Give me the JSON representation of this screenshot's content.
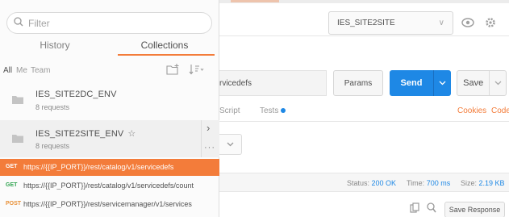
{
  "sidebar": {
    "search": {
      "placeholder": "Filter"
    },
    "tabs": [
      {
        "label": "History",
        "active": false
      },
      {
        "label": "Collections",
        "active": true
      }
    ],
    "filters": [
      {
        "label": "All",
        "active": true
      },
      {
        "label": "Me",
        "active": false
      },
      {
        "label": "Team",
        "active": false
      }
    ],
    "tools": {
      "new_collection_icon": "new-collection-icon",
      "sort_icon": "sort-icon"
    },
    "collections": [
      {
        "name": "IES_SITE2DC_ENV",
        "count": "8 requests"
      },
      {
        "name": "IES_SITE2SITE_ENV",
        "count": "8 requests",
        "star": "☆",
        "arrow": "›",
        "more": "···"
      }
    ],
    "requests": [
      {
        "method": "GET",
        "url": "https://{{IP_PORT}}/rest/catalog/v1/servicedefs",
        "active": true
      },
      {
        "method": "GET",
        "url": "https://{{IP_PORT}}/rest/catalog/v1/servicedefs/count",
        "active": false
      },
      {
        "method": "POST",
        "url": "https://{{IP_PORT}}/rest/servicemanager/v1/services",
        "active": false
      }
    ]
  },
  "main": {
    "environment": {
      "selected": "IES_SITE2SITE",
      "chevron": "∨"
    },
    "url_value": "rvicedefs",
    "params_label": "Params",
    "send_label": "Send",
    "save_label": "Save",
    "subtabs": {
      "script": "Script",
      "tests": "Tests",
      "cookies": "Cookies",
      "code": "Code"
    },
    "status": {
      "status_label": "Status:",
      "status_value": "200 OK",
      "time_label": "Time:",
      "time_value": "700 ms",
      "size_label": "Size:",
      "size_value": "2.19 KB"
    },
    "save_response_label": "Save Response"
  },
  "colors": {
    "accent": "#f37c3a",
    "send": "#1e88e5",
    "get": "#2fa34f",
    "post": "#e8923a"
  }
}
